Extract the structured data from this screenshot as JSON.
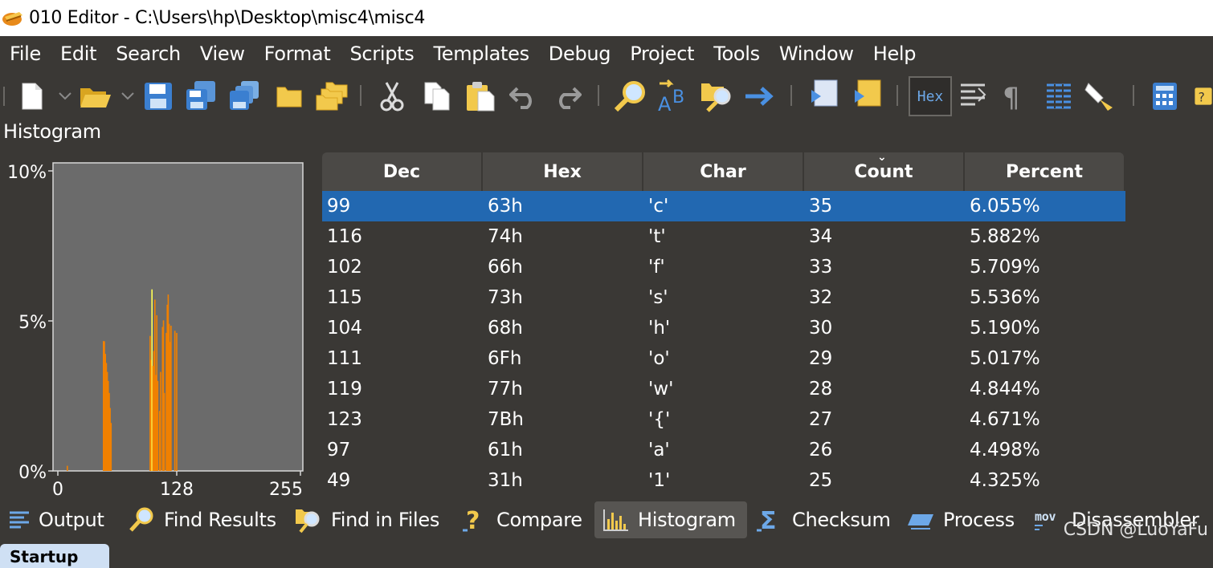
{
  "window": {
    "title": "010 Editor - C:\\Users\\hp\\Desktop\\misc4\\misc4"
  },
  "menu": [
    "File",
    "Edit",
    "Search",
    "View",
    "Format",
    "Scripts",
    "Templates",
    "Debug",
    "Project",
    "Tools",
    "Window",
    "Help"
  ],
  "toolbar": {
    "hex_label": "Hex",
    "icons": [
      "new-file-icon",
      "open-folder-icon",
      "save-icon",
      "save-as-icon",
      "save-all-icon",
      "folder-icon",
      "folders-icon",
      "cut-icon",
      "copy-icon",
      "paste-icon",
      "undo-icon",
      "redo-icon",
      "find-icon",
      "replace-icon",
      "find-in-files-icon",
      "goto-icon",
      "run-script-icon",
      "run-template-icon",
      "hex-mode-icon",
      "columns-icon",
      "paragraph-icon",
      "list-icon",
      "highlight-icon",
      "calculator-icon"
    ]
  },
  "panel": {
    "title": "Histogram"
  },
  "histogram": {
    "y_ticks": [
      "10%",
      "5%",
      "0%"
    ],
    "x_ticks": [
      "0",
      "128",
      "255"
    ],
    "bar_color": "#f08000",
    "highlight_color": "#ffff55"
  },
  "chart_data": {
    "type": "bar",
    "xlim": [
      0,
      255
    ],
    "ylim": [
      0,
      10
    ],
    "bars": [
      {
        "x": 10,
        "y": 0.17
      },
      {
        "x": 48,
        "y": 4.33
      },
      {
        "x": 49,
        "y": 4.32
      },
      {
        "x": 50,
        "y": 3.9
      },
      {
        "x": 51,
        "y": 3.6
      },
      {
        "x": 52,
        "y": 3.3
      },
      {
        "x": 53,
        "y": 3.0
      },
      {
        "x": 54,
        "y": 2.6
      },
      {
        "x": 55,
        "y": 2.1
      },
      {
        "x": 56,
        "y": 1.6
      },
      {
        "x": 97,
        "y": 4.5
      },
      {
        "x": 98,
        "y": 3.7
      },
      {
        "x": 99,
        "y": 6.05,
        "highlight": true
      },
      {
        "x": 100,
        "y": 3.5
      },
      {
        "x": 101,
        "y": 4.0
      },
      {
        "x": 102,
        "y": 5.71
      },
      {
        "x": 103,
        "y": 3.2
      },
      {
        "x": 104,
        "y": 5.19
      },
      {
        "x": 105,
        "y": 3.0
      },
      {
        "x": 107,
        "y": 2.0
      },
      {
        "x": 108,
        "y": 3.3
      },
      {
        "x": 110,
        "y": 4.8
      },
      {
        "x": 111,
        "y": 5.02
      },
      {
        "x": 112,
        "y": 2.6
      },
      {
        "x": 114,
        "y": 4.6
      },
      {
        "x": 115,
        "y": 5.54
      },
      {
        "x": 116,
        "y": 5.88
      },
      {
        "x": 117,
        "y": 4.9
      },
      {
        "x": 118,
        "y": 4.3
      },
      {
        "x": 119,
        "y": 4.84
      },
      {
        "x": 123,
        "y": 4.67
      },
      {
        "x": 125,
        "y": 4.6
      }
    ]
  },
  "table": {
    "columns": [
      "Dec",
      "Hex",
      "Char",
      "Count",
      "Percent"
    ],
    "sort_indicator": "⌄",
    "rows": [
      [
        "99",
        "63h",
        "'c'",
        "35",
        "6.055%"
      ],
      [
        "116",
        "74h",
        "'t'",
        "34",
        "5.882%"
      ],
      [
        "102",
        "66h",
        "'f'",
        "33",
        "5.709%"
      ],
      [
        "115",
        "73h",
        "'s'",
        "32",
        "5.536%"
      ],
      [
        "104",
        "68h",
        "'h'",
        "30",
        "5.190%"
      ],
      [
        "111",
        "6Fh",
        "'o'",
        "29",
        "5.017%"
      ],
      [
        "119",
        "77h",
        "'w'",
        "28",
        "4.844%"
      ],
      [
        "123",
        "7Bh",
        "'{'",
        "27",
        "4.671%"
      ],
      [
        "97",
        "61h",
        "'a'",
        "26",
        "4.498%"
      ],
      [
        "49",
        "31h",
        "'1'",
        "25",
        "4.325%"
      ]
    ]
  },
  "bottom_tabs": [
    {
      "label": "Output",
      "icon": "output-icon"
    },
    {
      "label": "Find Results",
      "icon": "find-results-icon"
    },
    {
      "label": "Find in Files",
      "icon": "find-in-files-icon"
    },
    {
      "label": "Compare",
      "icon": "compare-icon"
    },
    {
      "label": "Histogram",
      "icon": "histogram-icon",
      "active": true
    },
    {
      "label": "Checksum",
      "icon": "checksum-icon"
    },
    {
      "label": "Process",
      "icon": "process-icon"
    },
    {
      "label": "Disassembler",
      "icon": "disassembler-icon",
      "icon_text": "mov"
    }
  ],
  "startup_tab": "Startup",
  "watermark": "CSDN @LuoYaFu",
  "colors": {
    "background": "#3a3835",
    "selection": "#2268b1",
    "header": "#4b4946",
    "plot_bg": "#6b6b6b"
  }
}
